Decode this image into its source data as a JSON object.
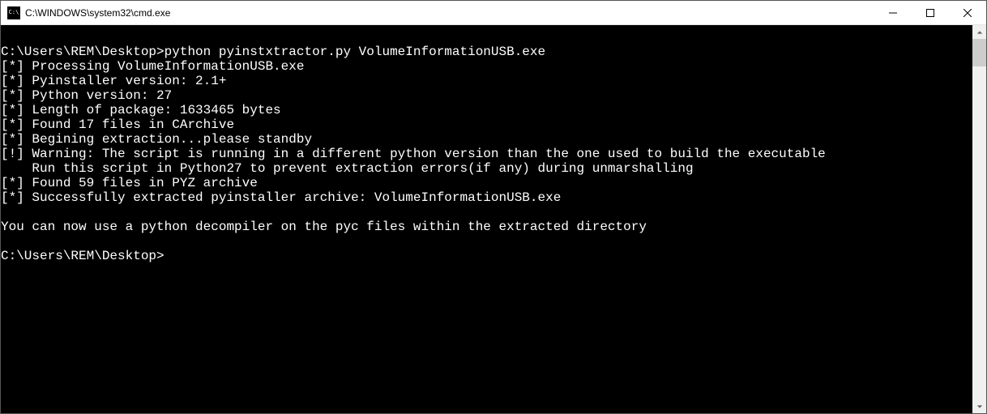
{
  "window": {
    "title": "C:\\WINDOWS\\system32\\cmd.exe"
  },
  "terminal": {
    "lines": [
      "",
      "C:\\Users\\REM\\Desktop>python pyinstxtractor.py VolumeInformationUSB.exe",
      "[*] Processing VolumeInformationUSB.exe",
      "[*] Pyinstaller version: 2.1+",
      "[*] Python version: 27",
      "[*] Length of package: 1633465 bytes",
      "[*] Found 17 files in CArchive",
      "[*] Begining extraction...please standby",
      "[!] Warning: The script is running in a different python version than the one used to build the executable",
      "    Run this script in Python27 to prevent extraction errors(if any) during unmarshalling",
      "[*] Found 59 files in PYZ archive",
      "[*] Successfully extracted pyinstaller archive: VolumeInformationUSB.exe",
      "",
      "You can now use a python decompiler on the pyc files within the extracted directory",
      "",
      "C:\\Users\\REM\\Desktop>"
    ]
  }
}
